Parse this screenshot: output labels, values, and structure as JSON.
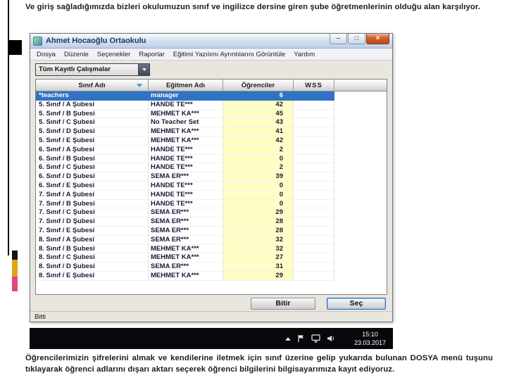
{
  "slide": {
    "top_text": "Ve giriş sağladığımızda bizleri okulumuzun  sınıf ve ingilizce dersine giren şube öğretmenlerinin olduğu alan karşılıyor.",
    "bottom_text": "Öğrencilerimizin şifrelerini almak ve kendilerine iletmek için sınıf üzerine gelip yukarıda bulunan DOSYA menü tuşunu tıklayarak öğrenci adlarını dışarı aktarı seçerek öğrenci bilgilerini bilgisayarımıza kayıt ediyoruz."
  },
  "app_window": {
    "title": "Ahmet Hocaoğlu Ortaokulu",
    "controls": {
      "minimize_icon": "–",
      "maximize_icon": "□",
      "close_icon": "×"
    },
    "menu": [
      "Dosya",
      "Düzenle",
      "Seçenekler",
      "Raporlar",
      "Eğitimi Yazılımı Ayrıntılarını Görüntüle",
      "Yardım"
    ],
    "filter_combo": {
      "value": "Tüm Kayıtlı Çalışmalar"
    },
    "table": {
      "columns": [
        "Sınıf Adı",
        "Eğitmen Adı",
        "Öğrenciler",
        "WSS"
      ],
      "sorted_column": "Sınıf Adı",
      "rows": [
        {
          "sinif": "*teachers",
          "egitmen": "manager",
          "ogrenciler": "6",
          "selected": true
        },
        {
          "sinif": "5. Sınıf / A Şubesi",
          "egitmen": "HANDE TE***",
          "ogrenciler": "42"
        },
        {
          "sinif": "5. Sınıf / B Şubesi",
          "egitmen": "MEHMET KA***",
          "ogrenciler": "45"
        },
        {
          "sinif": "5. Sınıf / C Şubesi",
          "egitmen": "No Teacher Set",
          "ogrenciler": "43"
        },
        {
          "sinif": "5. Sınıf / D Şubesi",
          "egitmen": "MEHMET KA***",
          "ogrenciler": "41"
        },
        {
          "sinif": "5. Sınıf / E Şubesi",
          "egitmen": "MEHMET KA***",
          "ogrenciler": "42"
        },
        {
          "sinif": "6. Sınıf / A Şubesi",
          "egitmen": "HANDE TE***",
          "ogrenciler": "2"
        },
        {
          "sinif": "6. Sınıf / B Şubesi",
          "egitmen": "HANDE TE***",
          "ogrenciler": "0"
        },
        {
          "sinif": "6. Sınıf / C Şubesi",
          "egitmen": "HANDE TE***",
          "ogrenciler": "2"
        },
        {
          "sinif": "6. Sınıf / D Şubesi",
          "egitmen": "SEMA ER***",
          "ogrenciler": "39"
        },
        {
          "sinif": "6. Sınıf / E Şubesi",
          "egitmen": "HANDE TE***",
          "ogrenciler": "0"
        },
        {
          "sinif": "7. Sınıf / A Şubesi",
          "egitmen": "HANDE TE***",
          "ogrenciler": "0"
        },
        {
          "sinif": "7. Sınıf / B Şubesi",
          "egitmen": "HANDE TE***",
          "ogrenciler": "0"
        },
        {
          "sinif": "7. Sınıf / C Şubesi",
          "egitmen": "SEMA ER***",
          "ogrenciler": "29"
        },
        {
          "sinif": "7. Sınıf / D Şubesi",
          "egitmen": "SEMA ER***",
          "ogrenciler": "28"
        },
        {
          "sinif": "7. Sınıf / E Şubesi",
          "egitmen": "SEMA ER***",
          "ogrenciler": "28"
        },
        {
          "sinif": "8. Sınıf / A Şubesi",
          "egitmen": "SEMA ER***",
          "ogrenciler": "32"
        },
        {
          "sinif": "8. Sınıf / B Şubesi",
          "egitmen": "MEHMET KA***",
          "ogrenciler": "32"
        },
        {
          "sinif": "8. Sınıf / C Şubesi",
          "egitmen": "MEHMET KA***",
          "ogrenciler": "27"
        },
        {
          "sinif": "8. Sınıf / D Şubesi",
          "egitmen": "SEMA ER***",
          "ogrenciler": "31"
        },
        {
          "sinif": "8. Sınıf / E Şubesi",
          "egitmen": "MEHMET KA***",
          "ogrenciler": "29"
        }
      ]
    },
    "buttons": {
      "finish": "Bitir",
      "select": "Seç"
    },
    "statusbar": "Bitti"
  },
  "taskbar": {
    "tray_icons": [
      "chevron-up-icon",
      "flag-icon",
      "monitor-icon",
      "speaker-icon"
    ],
    "time": "15:10",
    "date": "23.03.2017"
  },
  "colors": {
    "selection_blue": "#3072c3",
    "students_column_bg": "#ffffc4",
    "accent_yellow": "#dca616",
    "accent_pink": "#e2487e"
  }
}
